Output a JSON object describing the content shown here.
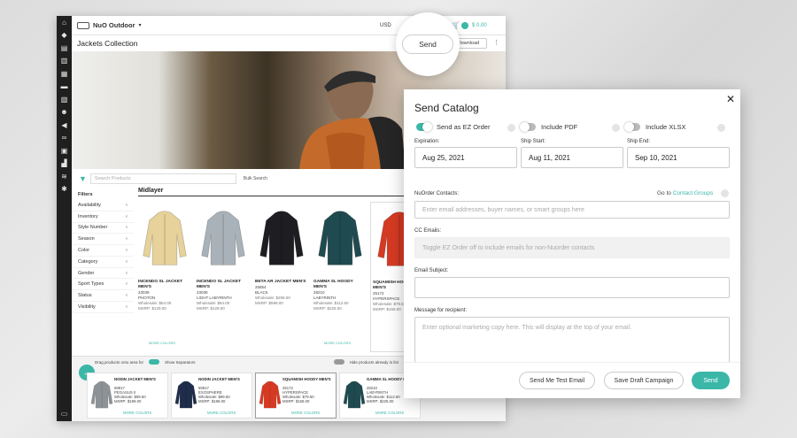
{
  "app": {
    "brand": "NuO Outdoor",
    "currency": "USD",
    "cart_amount": "$ 0.00",
    "page_title": "Jackets Collection",
    "download_label": "Download",
    "search_placeholder": "Search Products",
    "bulk_label": "Bulk Search",
    "filters_heading": "Filters",
    "filters": [
      "Availability",
      "Inventory",
      "Style Number",
      "Season",
      "Color",
      "Category",
      "Gender",
      "Sport Types",
      "Status",
      "Visibility"
    ],
    "section_title": "Midlayer",
    "products": [
      {
        "name": "INCENDO SL JACKET MEN'S",
        "style": "23039",
        "color": "PHOTON",
        "wholesale": "$64.00",
        "msrp": "$129.00",
        "color_hex": "#e6d29a"
      },
      {
        "name": "INCENDO SL JACKET MEN'S",
        "style": "23039",
        "color": "LIGHT LABYRINTH",
        "wholesale": "$64.00",
        "msrp": "$129.00",
        "color_hex": "#a9b2b8"
      },
      {
        "name": "BETA AR JACKET MEN'S",
        "style": "25854",
        "color": "BLACK",
        "wholesale": "$299.00",
        "msrp": "$599.00",
        "color_hex": "#1e1e22"
      },
      {
        "name": "GAMMA SL HOODY MEN'S",
        "style": "28210",
        "color": "LABYRINTH",
        "wholesale": "$112.50",
        "msrp": "$225.00",
        "color_hex": "#1f4a50"
      },
      {
        "name": "SQUAMISH HOODY MEN'S",
        "style": "25172",
        "color": "HYPERSPACE",
        "wholesale": "$79.50",
        "msrp": "$159.00",
        "color_hex": "#d63a22"
      }
    ],
    "more_colors": "MORE COLORS",
    "wholesale_label": "Wholesale:",
    "msrp_label": "MSRP:",
    "bottom": {
      "drag_text": "Drag products onto area for",
      "show_separators": "Show Separators",
      "hide_in_list": "Hide products already in list",
      "cards": [
        {
          "name": "NODIN JACKET MEN'S",
          "style": "59917",
          "color": "PEGASUS II",
          "wholesale": "$99.50",
          "msrp": "$199.00",
          "color_hex": "#8d9296"
        },
        {
          "name": "NODIN JACKET MEN'S",
          "style": "59917",
          "color": "EXOSPHERE",
          "wholesale": "$99.50",
          "msrp": "$199.00",
          "color_hex": "#1f2d4a"
        },
        {
          "name": "SQUAMISH HOODY MEN'S",
          "style": "25172",
          "color": "HYPERSPACE",
          "wholesale": "$79.50",
          "msrp": "$159.00",
          "color_hex": "#d63a22"
        },
        {
          "name": "GAMMA SL HOODY MEN'S",
          "style": "28210",
          "color": "LABYRINTH",
          "wholesale": "$112.50",
          "msrp": "$225.00",
          "color_hex": "#1f4a50"
        }
      ]
    }
  },
  "callout": {
    "send_label": "Send"
  },
  "modal": {
    "title": "Send Catalog",
    "toggles": [
      {
        "label": "Send as EZ Order",
        "on": true
      },
      {
        "label": "Include PDF",
        "on": false
      },
      {
        "label": "Include XLSX",
        "on": false
      }
    ],
    "expiration_label": "Expiration:",
    "expiration_value": "Aug 25, 2021",
    "ship_start_label": "Ship Start:",
    "ship_start_value": "Aug 11, 2021",
    "ship_end_label": "Ship End:",
    "ship_end_value": "Sep 10, 2021",
    "contacts_label": "NuOrder Contacts:",
    "go_to": "Go to",
    "contact_groups": "Contact Groups",
    "contacts_placeholder": "Enter email addresses, buyer names, or smart groups here",
    "cc_label": "CC Emails:",
    "cc_placeholder": "Toggle EZ Order off to include emails for non-Nuorder contacts",
    "subject_label": "Email Subject:",
    "subject_value": "",
    "message_label": "Message for recipient:",
    "message_placeholder": "Enter optional marketing copy here. This will display at the top of your email.",
    "buttons": {
      "test": "Send Me Test Email",
      "draft": "Save Draft Campaign",
      "send": "Send"
    }
  },
  "colors": {
    "accent": "#3bb7a8",
    "rail": "#1f1f1f"
  }
}
